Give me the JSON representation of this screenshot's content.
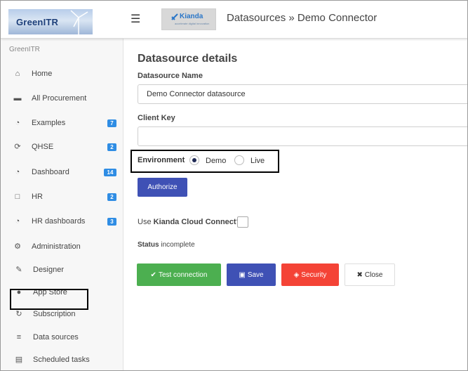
{
  "brand": {
    "logo_text": "GreenITR",
    "kianda_name": "Kianda",
    "kianda_tagline": "accelerate digital innovation"
  },
  "header": {
    "title": "Datasources » Demo Connector",
    "menu_icon": "☰"
  },
  "sidebar": {
    "title": "GreenITR",
    "items": [
      {
        "label": "Home",
        "icon": "⌂",
        "icon_name": "home-icon",
        "badge": ""
      },
      {
        "label": "All Procurement",
        "icon": "▬",
        "icon_name": "cart-icon",
        "badge": ""
      },
      {
        "label": "Examples",
        "icon": "◔",
        "icon_name": "gauge-icon",
        "badge": "7"
      },
      {
        "label": "QHSE",
        "icon": "⟳",
        "icon_name": "refresh-icon",
        "badge": "2"
      },
      {
        "label": "Dashboard",
        "icon": "◔",
        "icon_name": "gauge-icon",
        "badge": "14"
      },
      {
        "label": "HR",
        "icon": "□",
        "icon_name": "clipboard-icon",
        "badge": "2"
      },
      {
        "label": "HR dashboards",
        "icon": "◔",
        "icon_name": "gauge-icon",
        "badge": "3"
      },
      {
        "label": "Administration",
        "icon": "⚙",
        "icon_name": "gear-icon",
        "badge": ""
      },
      {
        "label": "Designer",
        "icon": "✎",
        "icon_name": "edit-icon",
        "badge": ""
      },
      {
        "label": "App Store",
        "icon": "●",
        "icon_name": "globe-icon",
        "badge": ""
      },
      {
        "label": "Subscription",
        "icon": "↻",
        "icon_name": "renew-icon",
        "badge": ""
      },
      {
        "label": "Data sources",
        "icon": "≡",
        "icon_name": "database-icon",
        "badge": ""
      },
      {
        "label": "Scheduled tasks",
        "icon": "▤",
        "icon_name": "tasks-icon",
        "badge": ""
      }
    ]
  },
  "form": {
    "section_title": "Datasource details",
    "name_label": "Datasource Name",
    "name_value": "Demo Connector datasource",
    "key_label": "Client Key",
    "key_value": "",
    "environment_label": "Environment",
    "env_options": [
      "Demo",
      "Live"
    ],
    "env_selected": "Demo",
    "authorize_label": "Authorize",
    "cloud_label_prefix": "Use ",
    "cloud_label_bold": "Kianda Cloud Connect?",
    "cloud_checked": false,
    "status_label": "Status",
    "status_value": "incomplete"
  },
  "actions": {
    "test_label": "Test connection",
    "save_label": "Save",
    "security_label": "Security",
    "close_label": "Close"
  },
  "colors": {
    "primary": "#3f51b5",
    "success": "#4caf50",
    "danger": "#f44336",
    "badge": "#2f8de4"
  }
}
